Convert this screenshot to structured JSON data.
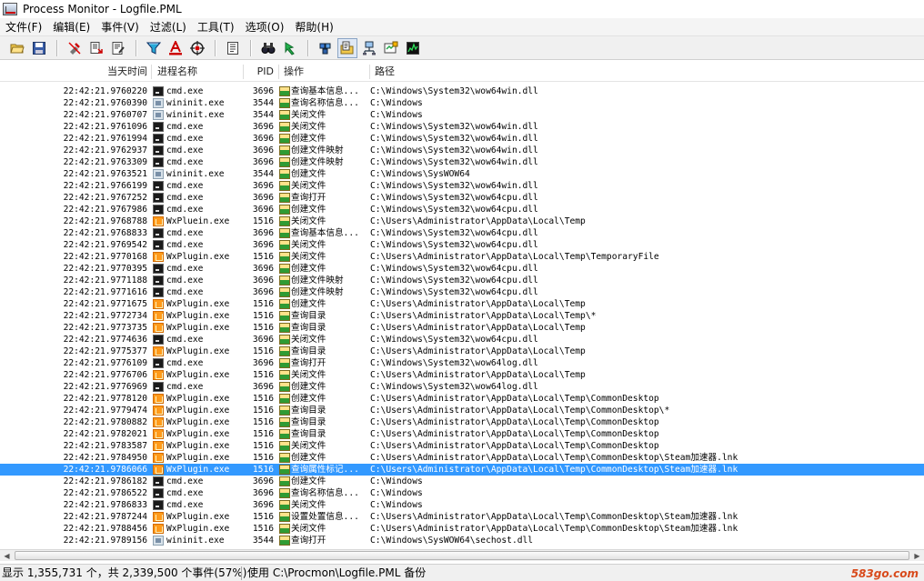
{
  "window": {
    "title": "Process Monitor - Logfile.PML"
  },
  "menu": [
    "文件(F)",
    "编辑(E)",
    "事件(V)",
    "过滤(L)",
    "工具(T)",
    "选项(O)",
    "帮助(H)"
  ],
  "toolbar_icons": [
    "open-folder-icon",
    "save-icon",
    "separator",
    "capture-off-icon",
    "autoscroll-icon",
    "clear-display-icon",
    "separator",
    "filter-icon",
    "highlight-icon",
    "include-process-icon",
    "separator",
    "process-tree-icon",
    "separator",
    "find-icon",
    "jump-to-icon",
    "separator",
    "registry-activity-icon",
    "file-activity-icon",
    "network-activity-icon",
    "process-activity-icon",
    "profiling-events-icon"
  ],
  "columns": {
    "time": "当天时间",
    "process": "进程名称",
    "pid": "PID",
    "operation": "操作",
    "path": "路径"
  },
  "rows": [
    {
      "time": "22:42:21.9760220",
      "icon": "cmd",
      "process": "cmd.exe",
      "pid": "3696",
      "op": "查询基本信息...",
      "path": "C:\\Windows\\System32\\wow64win.dll"
    },
    {
      "time": "22:42:21.9760390",
      "icon": "wininit",
      "process": "wininit.exe",
      "pid": "3544",
      "op": "查询名称信息...",
      "path": "C:\\Windows"
    },
    {
      "time": "22:42:21.9760707",
      "icon": "wininit",
      "process": "wininit.exe",
      "pid": "3544",
      "op": "关闭文件",
      "path": "C:\\Windows"
    },
    {
      "time": "22:42:21.9761096",
      "icon": "cmd",
      "process": "cmd.exe",
      "pid": "3696",
      "op": "关闭文件",
      "path": "C:\\Windows\\System32\\wow64win.dll"
    },
    {
      "time": "22:42:21.9761994",
      "icon": "cmd",
      "process": "cmd.exe",
      "pid": "3696",
      "op": "创建文件",
      "path": "C:\\Windows\\System32\\wow64win.dll"
    },
    {
      "time": "22:42:21.9762937",
      "icon": "cmd",
      "process": "cmd.exe",
      "pid": "3696",
      "op": "创建文件映射",
      "path": "C:\\Windows\\System32\\wow64win.dll"
    },
    {
      "time": "22:42:21.9763309",
      "icon": "cmd",
      "process": "cmd.exe",
      "pid": "3696",
      "op": "创建文件映射",
      "path": "C:\\Windows\\System32\\wow64win.dll"
    },
    {
      "time": "22:42:21.9763521",
      "icon": "wininit",
      "process": "wininit.exe",
      "pid": "3544",
      "op": "创建文件",
      "path": "C:\\Windows\\SysWOW64"
    },
    {
      "time": "22:42:21.9766199",
      "icon": "cmd",
      "process": "cmd.exe",
      "pid": "3696",
      "op": "关闭文件",
      "path": "C:\\Windows\\System32\\wow64win.dll"
    },
    {
      "time": "22:42:21.9767252",
      "icon": "cmd",
      "process": "cmd.exe",
      "pid": "3696",
      "op": "查询打开",
      "path": "C:\\Windows\\System32\\wow64cpu.dll"
    },
    {
      "time": "22:42:21.9767986",
      "icon": "cmd",
      "process": "cmd.exe",
      "pid": "3696",
      "op": "创建文件",
      "path": "C:\\Windows\\System32\\wow64cpu.dll"
    },
    {
      "time": "22:42:21.9768788",
      "icon": "wx",
      "process": "WxPluein.exe",
      "pid": "1516",
      "op": "关闭文件",
      "path": "C:\\Users\\Administrator\\AppData\\Local\\Temp"
    },
    {
      "time": "22:42:21.9768833",
      "icon": "cmd",
      "process": "cmd.exe",
      "pid": "3696",
      "op": "查询基本信息...",
      "path": "C:\\Windows\\System32\\wow64cpu.dll"
    },
    {
      "time": "22:42:21.9769542",
      "icon": "cmd",
      "process": "cmd.exe",
      "pid": "3696",
      "op": "关闭文件",
      "path": "C:\\Windows\\System32\\wow64cpu.dll"
    },
    {
      "time": "22:42:21.9770168",
      "icon": "wx",
      "process": "WxPlugin.exe",
      "pid": "1516",
      "op": "关闭文件",
      "path": "C:\\Users\\Administrator\\AppData\\Local\\Temp\\TemporaryFile"
    },
    {
      "time": "22:42:21.9770395",
      "icon": "cmd",
      "process": "cmd.exe",
      "pid": "3696",
      "op": "创建文件",
      "path": "C:\\Windows\\System32\\wow64cpu.dll"
    },
    {
      "time": "22:42:21.9771188",
      "icon": "cmd",
      "process": "cmd.exe",
      "pid": "3696",
      "op": "创建文件映射",
      "path": "C:\\Windows\\System32\\wow64cpu.dll"
    },
    {
      "time": "22:42:21.9771616",
      "icon": "cmd",
      "process": "cmd.exe",
      "pid": "3696",
      "op": "创建文件映射",
      "path": "C:\\Windows\\System32\\wow64cpu.dll"
    },
    {
      "time": "22:42:21.9771675",
      "icon": "wx",
      "process": "WxPlugin.exe",
      "pid": "1516",
      "op": "创建文件",
      "path": "C:\\Users\\Administrator\\AppData\\Local\\Temp"
    },
    {
      "time": "22:42:21.9772734",
      "icon": "wx",
      "process": "WxPlugin.exe",
      "pid": "1516",
      "op": "查询目录",
      "path": "C:\\Users\\Administrator\\AppData\\Local\\Temp\\*"
    },
    {
      "time": "22:42:21.9773735",
      "icon": "wx",
      "process": "WxPlugin.exe",
      "pid": "1516",
      "op": "查询目录",
      "path": "C:\\Users\\Administrator\\AppData\\Local\\Temp"
    },
    {
      "time": "22:42:21.9774636",
      "icon": "cmd",
      "process": "cmd.exe",
      "pid": "3696",
      "op": "关闭文件",
      "path": "C:\\Windows\\System32\\wow64cpu.dll"
    },
    {
      "time": "22:42:21.9775377",
      "icon": "wx",
      "process": "WxPlugin.exe",
      "pid": "1516",
      "op": "查询目录",
      "path": "C:\\Users\\Administrator\\AppData\\Local\\Temp"
    },
    {
      "time": "22:42:21.9776109",
      "icon": "cmd",
      "process": "cmd.exe",
      "pid": "3696",
      "op": "查询打开",
      "path": "C:\\Windows\\System32\\wow64log.dll"
    },
    {
      "time": "22:42:21.9776706",
      "icon": "wx",
      "process": "WxPlugin.exe",
      "pid": "1516",
      "op": "关闭文件",
      "path": "C:\\Users\\Administrator\\AppData\\Local\\Temp"
    },
    {
      "time": "22:42:21.9776969",
      "icon": "cmd",
      "process": "cmd.exe",
      "pid": "3696",
      "op": "创建文件",
      "path": "C:\\Windows\\System32\\wow64log.dll"
    },
    {
      "time": "22:42:21.9778120",
      "icon": "wx",
      "process": "WxPlugin.exe",
      "pid": "1516",
      "op": "创建文件",
      "path": "C:\\Users\\Administrator\\AppData\\Local\\Temp\\CommonDesktop"
    },
    {
      "time": "22:42:21.9779474",
      "icon": "wx",
      "process": "WxPlugin.exe",
      "pid": "1516",
      "op": "查询目录",
      "path": "C:\\Users\\Administrator\\AppData\\Local\\Temp\\CommonDesktop\\*"
    },
    {
      "time": "22:42:21.9780882",
      "icon": "wx",
      "process": "WxPlugin.exe",
      "pid": "1516",
      "op": "查询目录",
      "path": "C:\\Users\\Administrator\\AppData\\Local\\Temp\\CommonDesktop"
    },
    {
      "time": "22:42:21.9782021",
      "icon": "wx",
      "process": "WxPlugin.exe",
      "pid": "1516",
      "op": "查询目录",
      "path": "C:\\Users\\Administrator\\AppData\\Local\\Temp\\CommonDesktop"
    },
    {
      "time": "22:42:21.9783587",
      "icon": "wx",
      "process": "WxPlugin.exe",
      "pid": "1516",
      "op": "关闭文件",
      "path": "C:\\Users\\Administrator\\AppData\\Local\\Temp\\CommonDesktop"
    },
    {
      "time": "22:42:21.9784950",
      "icon": "wx",
      "process": "WxPlugin.exe",
      "pid": "1516",
      "op": "创建文件",
      "path": "C:\\Users\\Administrator\\AppData\\Local\\Temp\\CommonDesktop\\Steam加速器.lnk"
    },
    {
      "time": "22:42:21.9786066",
      "icon": "wx",
      "process": "WxPlugin.exe",
      "pid": "1516",
      "op": "查询属性标记...",
      "path": "C:\\Users\\Administrator\\AppData\\Local\\Temp\\CommonDesktop\\Steam加速器.lnk",
      "selected": true
    },
    {
      "time": "22:42:21.9786182",
      "icon": "cmd",
      "process": "cmd.exe",
      "pid": "3696",
      "op": "创建文件",
      "path": "C:\\Windows"
    },
    {
      "time": "22:42:21.9786522",
      "icon": "cmd",
      "process": "cmd.exe",
      "pid": "3696",
      "op": "查询名称信息...",
      "path": "C:\\Windows"
    },
    {
      "time": "22:42:21.9786833",
      "icon": "cmd",
      "process": "cmd.exe",
      "pid": "3696",
      "op": "关闭文件",
      "path": "C:\\Windows"
    },
    {
      "time": "22:42:21.9787244",
      "icon": "wx",
      "process": "WxPlugin.exe",
      "pid": "1516",
      "op": "设置处置信息...",
      "path": "C:\\Users\\Administrator\\AppData\\Local\\Temp\\CommonDesktop\\Steam加速器.lnk"
    },
    {
      "time": "22:42:21.9788456",
      "icon": "wx",
      "process": "WxPlugin.exe",
      "pid": "1516",
      "op": "关闭文件",
      "path": "C:\\Users\\Administrator\\AppData\\Local\\Temp\\CommonDesktop\\Steam加速器.lnk"
    },
    {
      "time": "22:42:21.9789156",
      "icon": "wininit",
      "process": "wininit.exe",
      "pid": "3544",
      "op": "查询打开",
      "path": "C:\\Windows\\SysWOW64\\sechost.dll"
    }
  ],
  "status": {
    "events": "显示 1,355,731 个，共 2,339,500 个事件(57%)",
    "backing": "使用 C:\\Procmon\\Logfile.PML 备份",
    "watermark": "583go.com"
  }
}
